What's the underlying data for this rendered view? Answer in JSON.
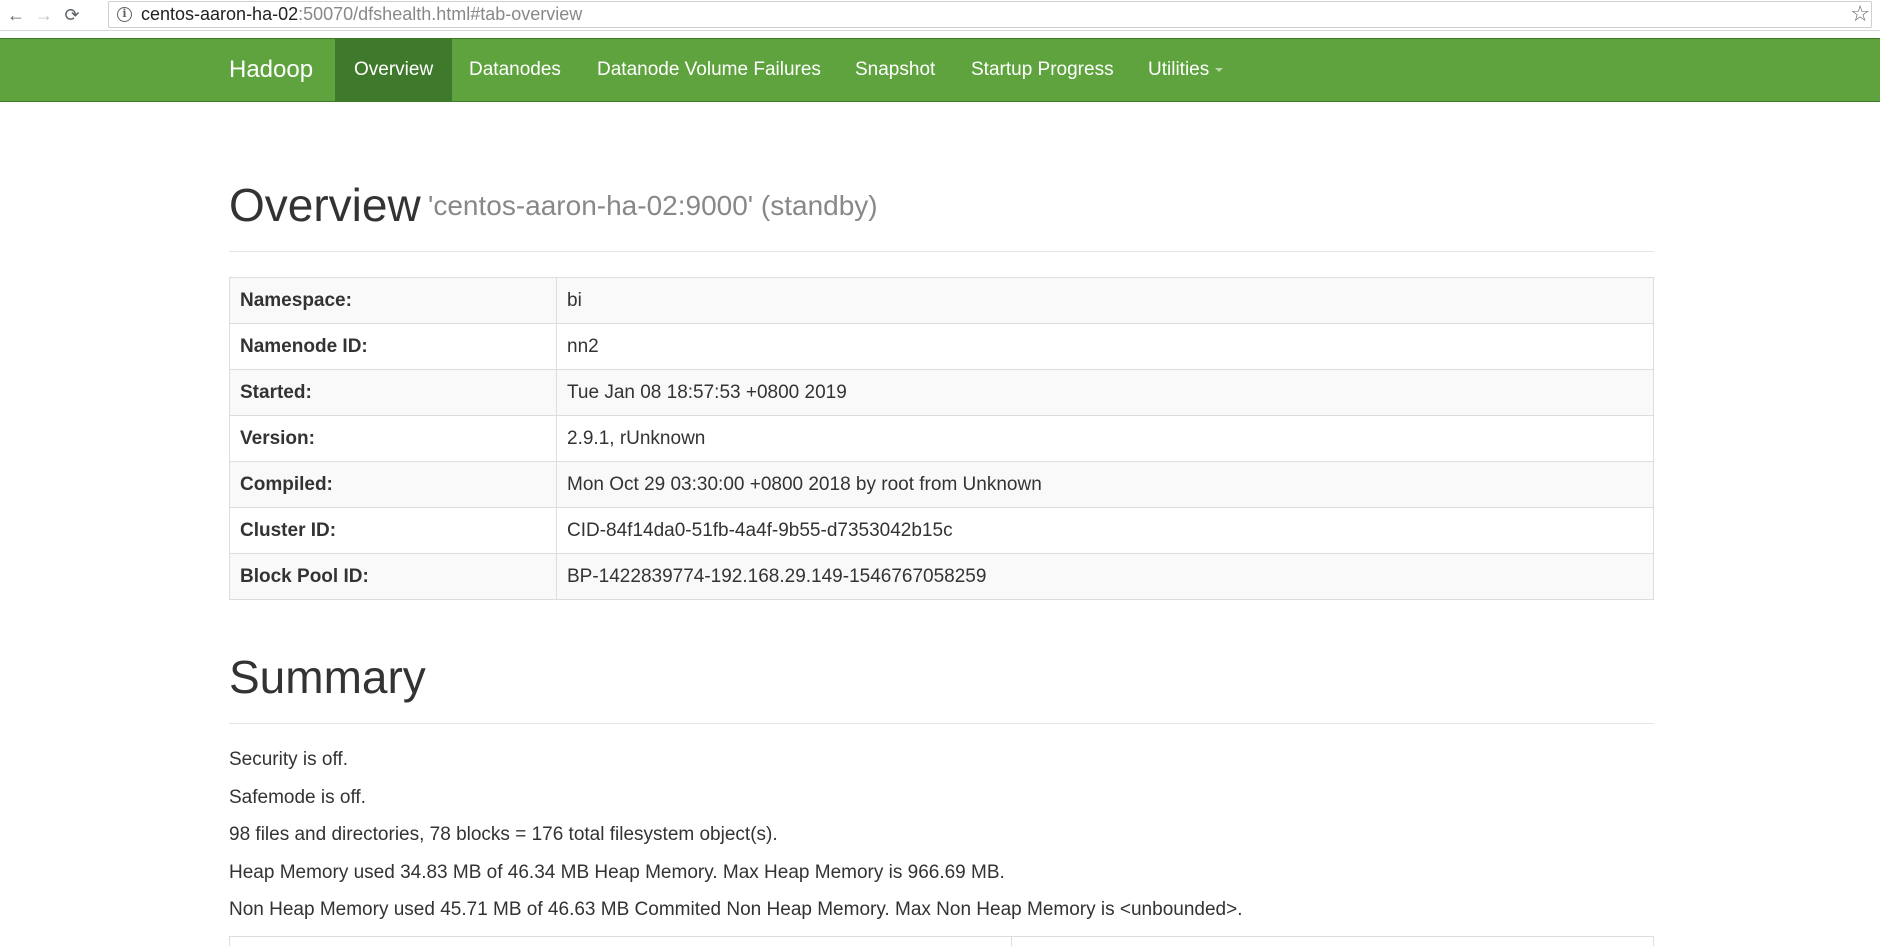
{
  "browser": {
    "back_glyph": "←",
    "forward_glyph": "→",
    "reload_glyph": "⟳",
    "info_glyph": "i",
    "url_host": "centos-aaron-ha-02",
    "url_rest": ":50070/dfshealth.html#tab-overview",
    "star_glyph": "☆"
  },
  "navbar": {
    "brand": "Hadoop",
    "items": [
      {
        "label": "Overview",
        "active": true
      },
      {
        "label": "Datanodes"
      },
      {
        "label": "Datanode Volume Failures"
      },
      {
        "label": "Snapshot"
      },
      {
        "label": "Startup Progress"
      },
      {
        "label": "Utilities",
        "dropdown": true
      }
    ],
    "bg_color": "#5fa33e",
    "active_color": "#3f7a2c"
  },
  "overview": {
    "title": "Overview",
    "subtitle": "'centos-aaron-ha-02:9000' (standby)",
    "rows": [
      {
        "key": "Namespace:",
        "value": "bi"
      },
      {
        "key": "Namenode ID:",
        "value": "nn2"
      },
      {
        "key": "Started:",
        "value": "Tue Jan 08 18:57:53 +0800 2019"
      },
      {
        "key": "Version:",
        "value": "2.9.1, rUnknown"
      },
      {
        "key": "Compiled:",
        "value": "Mon Oct 29 03:30:00 +0800 2018 by root from Unknown"
      },
      {
        "key": "Cluster ID:",
        "value": "CID-84f14da0-51fb-4a4f-9b55-d7353042b15c"
      },
      {
        "key": "Block Pool ID:",
        "value": "BP-1422839774-192.168.29.149-1546767058259"
      }
    ]
  },
  "summary": {
    "title": "Summary",
    "lines": [
      "Security is off.",
      "Safemode is off.",
      "98 files and directories, 78 blocks = 176 total filesystem object(s).",
      "Heap Memory used 34.83 MB of 46.34 MB Heap Memory. Max Heap Memory is 966.69 MB.",
      "Non Heap Memory used 45.71 MB of 46.63 MB Commited Non Heap Memory. Max Non Heap Memory is <unbounded>."
    ]
  }
}
